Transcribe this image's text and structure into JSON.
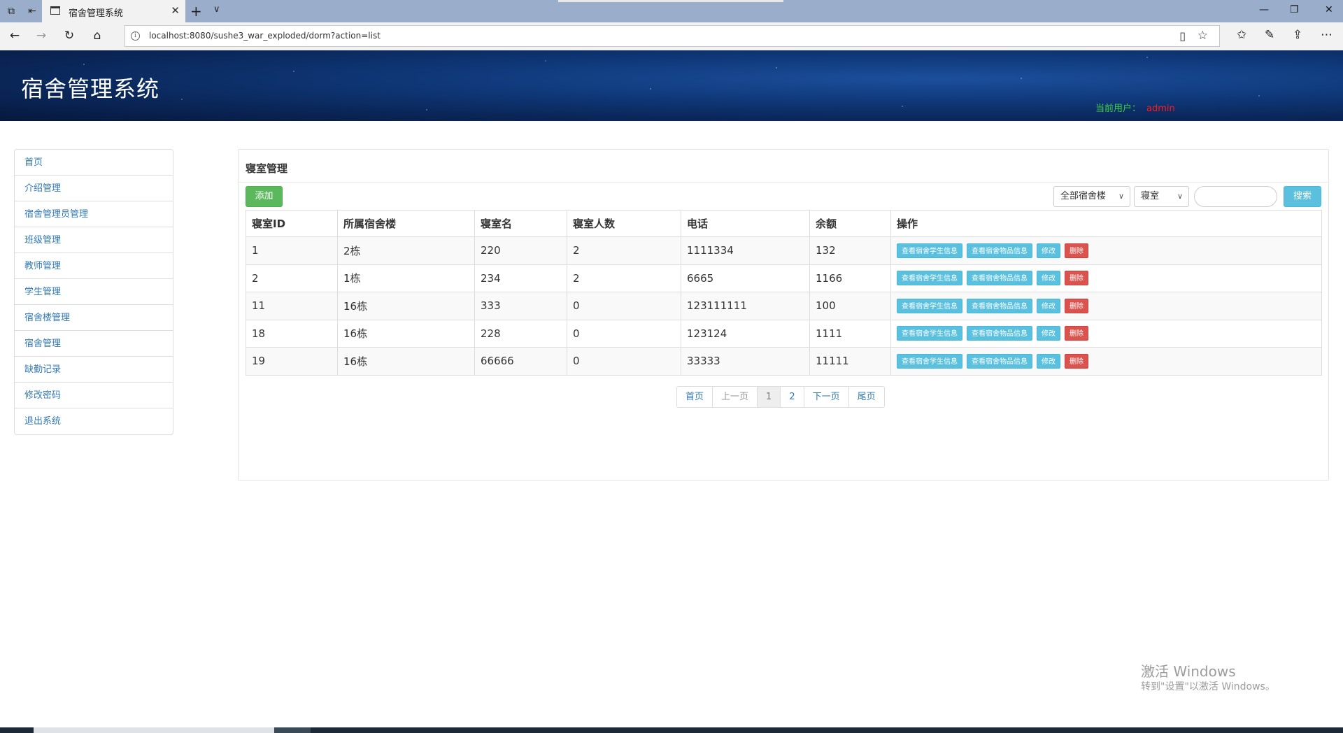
{
  "browser": {
    "tab_title": "宿舍管理系统",
    "url": "localhost:8080/sushe3_war_exploded/dorm?action=list"
  },
  "header": {
    "title": "宿舍管理系统",
    "user_label": "当前用户：",
    "user_name": "admin"
  },
  "sidebar": {
    "items": [
      {
        "label": "首页"
      },
      {
        "label": "介绍管理"
      },
      {
        "label": "宿舍管理员管理"
      },
      {
        "label": "班级管理"
      },
      {
        "label": "教师管理"
      },
      {
        "label": "学生管理"
      },
      {
        "label": "宿舍楼管理"
      },
      {
        "label": "宿舍管理"
      },
      {
        "label": "缺勤记录"
      },
      {
        "label": "修改密码"
      },
      {
        "label": "退出系统"
      }
    ]
  },
  "main": {
    "title": "寝室管理",
    "add_label": "添加",
    "building_select": "全部宿舍楼",
    "field_select": "寝室",
    "search_value": "",
    "search_label": "搜索",
    "columns": [
      "寝室ID",
      "所属宿舍楼",
      "寝室名",
      "寝室人数",
      "电话",
      "余额",
      "操作"
    ],
    "actions": {
      "view_students": "查看宿舍学生信息",
      "view_items": "查看宿舍物品信息",
      "edit": "修改",
      "delete": "删除"
    },
    "rows": [
      {
        "id": "1",
        "building": "2栋",
        "name": "220",
        "count": "2",
        "phone": "1111334",
        "balance": "132"
      },
      {
        "id": "2",
        "building": "1栋",
        "name": "234",
        "count": "2",
        "phone": "6665",
        "balance": "1166"
      },
      {
        "id": "11",
        "building": "16栋",
        "name": "333",
        "count": "0",
        "phone": "123111111",
        "balance": "100"
      },
      {
        "id": "18",
        "building": "16栋",
        "name": "228",
        "count": "0",
        "phone": "123124",
        "balance": "1111"
      },
      {
        "id": "19",
        "building": "16栋",
        "name": "66666",
        "count": "0",
        "phone": "33333",
        "balance": "11111"
      }
    ],
    "pagination": {
      "first": "首页",
      "prev": "上一页",
      "page1": "1",
      "page2": "2",
      "next": "下一页",
      "last": "尾页"
    }
  },
  "watermark": {
    "title": "激活 Windows",
    "subtitle": "转到\"设置\"以激活 Windows。"
  },
  "colors": {
    "sidebar_link": "#337ab7",
    "btn_add": "#5cb85c",
    "btn_info": "#5bc0de",
    "btn_danger": "#d9534f",
    "user_label": "#3fce3f",
    "user_name": "#ff1a1a"
  }
}
